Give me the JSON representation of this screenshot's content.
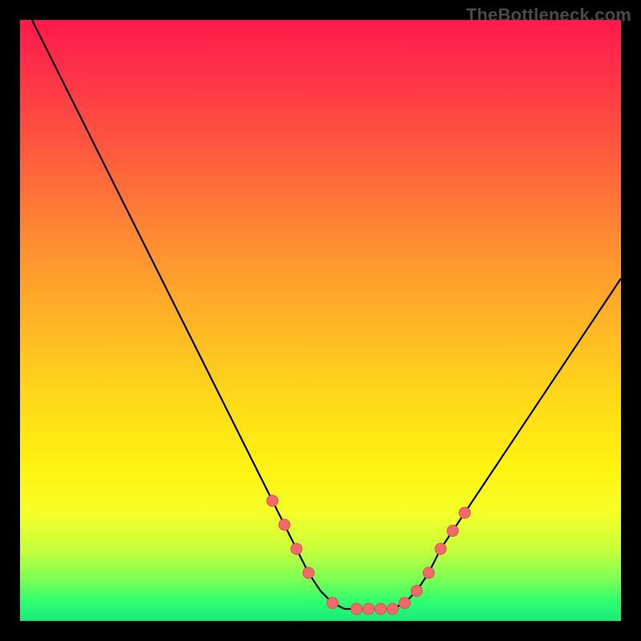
{
  "watermark": "TheBottleneck.com",
  "colors": {
    "frame": "#000000",
    "curve": "#000000",
    "marker_fill": "#f06a6a",
    "marker_stroke": "#d94f4f",
    "gradient_stops": [
      "#ff1a4b",
      "#ff5a3e",
      "#ff8a33",
      "#ffb426",
      "#ffd61a",
      "#fff210",
      "#c8ff3a",
      "#2bff6f"
    ]
  },
  "chart_data": {
    "type": "line",
    "title": "",
    "xlabel": "",
    "ylabel": "",
    "xlim": [
      0,
      100
    ],
    "ylim": [
      0,
      100
    ],
    "grid": false,
    "series": [
      {
        "name": "bottleneck-curve",
        "x": [
          2,
          6,
          10,
          14,
          18,
          22,
          26,
          30,
          34,
          38,
          42,
          44,
          46,
          48,
          50,
          52,
          54,
          56,
          58,
          60,
          62,
          64,
          66,
          68,
          70,
          74,
          78,
          82,
          86,
          90,
          94,
          98,
          100
        ],
        "y": [
          100,
          92,
          84,
          76,
          68,
          60,
          52,
          44,
          36,
          28,
          20,
          16,
          12,
          8,
          5,
          3,
          2,
          2,
          2,
          2,
          2,
          3,
          5,
          8,
          12,
          18,
          24,
          30,
          36,
          42,
          48,
          54,
          57
        ]
      }
    ],
    "markers": {
      "name": "highlighted-points",
      "x": [
        42,
        44,
        46,
        48,
        52,
        56,
        58,
        60,
        62,
        64,
        66,
        68,
        70,
        72,
        74
      ],
      "y": [
        20,
        16,
        12,
        8,
        3,
        2,
        2,
        2,
        2,
        3,
        5,
        8,
        12,
        15,
        18
      ]
    }
  }
}
